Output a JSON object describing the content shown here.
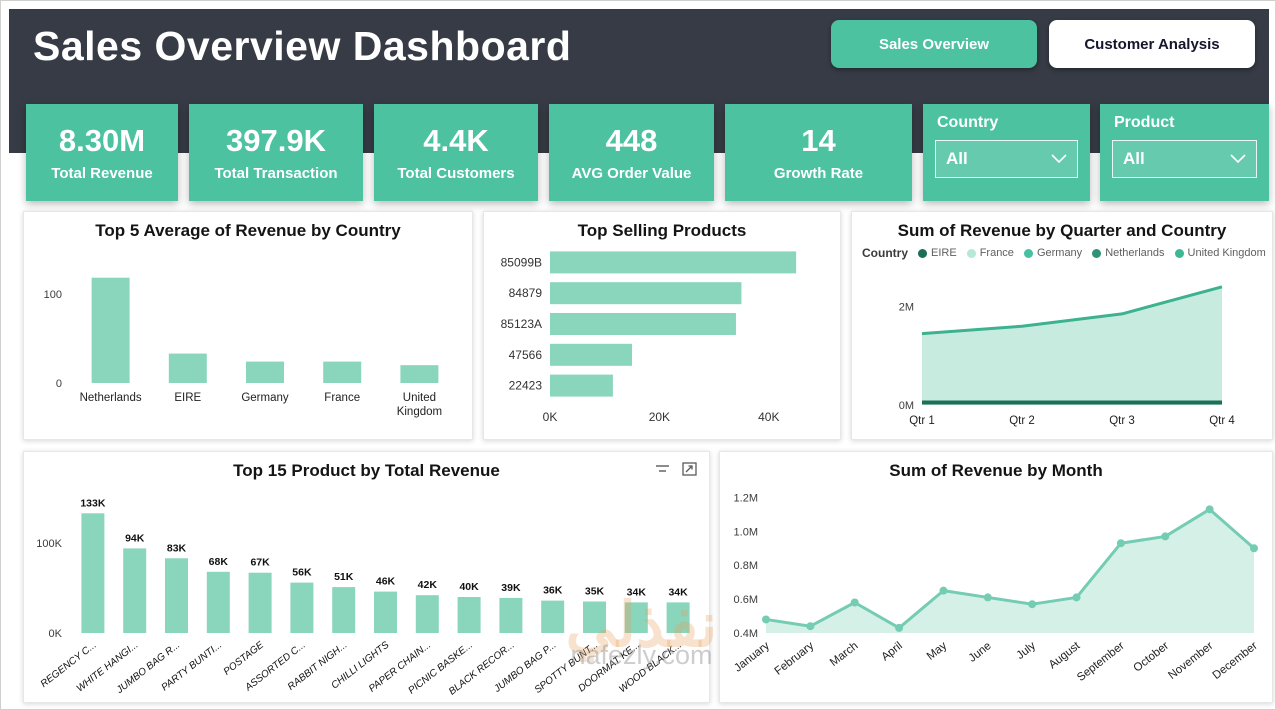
{
  "header": {
    "title": "Sales Overview Dashboard",
    "tabs": [
      {
        "label": "Sales Overview",
        "active": true
      },
      {
        "label": "Customer Analysis",
        "active": false
      }
    ]
  },
  "kpis": [
    {
      "value": "8.30M",
      "label": "Total Revenue"
    },
    {
      "value": "397.9K",
      "label": "Total Transaction"
    },
    {
      "value": "4.4K",
      "label": "Total Customers"
    },
    {
      "value": "448",
      "label": "AVG Order Value"
    },
    {
      "value": "14",
      "label": "Growth Rate"
    }
  ],
  "slicers": [
    {
      "label": "Country",
      "value": "All"
    },
    {
      "label": "Product",
      "value": "All"
    }
  ],
  "colors": {
    "accent": "#4cc2a0",
    "header_bg": "#363b45",
    "bar": "#8ad6bd",
    "area_stroke": "#3db28f",
    "area_fill": "#c8ebdf",
    "dark_series": "#1c6f58",
    "month_stroke": "#74ccb3",
    "month_fill": "#d5f0e7"
  },
  "watermark": {
    "arabic": "نفذلي",
    "domain": "nafezly.com"
  },
  "chart_data": [
    {
      "type": "bar",
      "title": "Top 5 Average of Revenue by Country",
      "categories": [
        "Netherlands",
        "EIRE",
        "Germany",
        "France",
        "United Kingdom"
      ],
      "values": [
        118,
        33,
        24,
        24,
        20
      ],
      "ylim": [
        0,
        130
      ],
      "yticks": [
        {
          "v": 100,
          "label": "100"
        },
        {
          "v": 0,
          "label": "0"
        }
      ],
      "color": "#8ad6bd",
      "grid": false,
      "xlabel": "",
      "ylabel": ""
    },
    {
      "type": "bar",
      "orientation": "horizontal",
      "title": "Top Selling Products",
      "categories": [
        "85099B",
        "84879",
        "85123A",
        "47566",
        "22423"
      ],
      "values": [
        45,
        35,
        34,
        15,
        11.5
      ],
      "unit": "K",
      "xlim": [
        0,
        49
      ],
      "xticks": [
        {
          "v": 0,
          "label": "0K"
        },
        {
          "v": 20,
          "label": "20K"
        },
        {
          "v": 40,
          "label": "40K"
        }
      ],
      "color": "#8ad6bd",
      "grid": false
    },
    {
      "type": "area",
      "title": "Sum of Revenue by Quarter and Country",
      "legend_title": "Country",
      "legend_position": "top",
      "legend": [
        {
          "label": "EIRE",
          "color": "#1b6e55"
        },
        {
          "label": "France",
          "color": "#b7e7d5"
        },
        {
          "label": "Germany",
          "color": "#46c1a1"
        },
        {
          "label": "Netherlands",
          "color": "#2f9377"
        },
        {
          "label": "United Kingdom",
          "color": "#3eb892"
        }
      ],
      "categories": [
        "Qtr 1",
        "Qtr 2",
        "Qtr 3",
        "Qtr 4"
      ],
      "series": [
        {
          "name": "United Kingdom",
          "values": [
            1.45,
            1.6,
            1.85,
            2.4
          ],
          "stroke": "#3db28f",
          "fill": "#c8ebdf",
          "width": 3
        },
        {
          "name": "EIRE",
          "values": [
            0.05,
            0.05,
            0.05,
            0.05
          ],
          "stroke": "#1c6f58",
          "width": 4
        }
      ],
      "ylim": [
        0,
        2.6
      ],
      "yticks": [
        {
          "v": 2,
          "label": "2M"
        },
        {
          "v": 0,
          "label": "0M"
        }
      ],
      "grid": false
    },
    {
      "type": "bar",
      "title": "Top 15 Product by Total Revenue",
      "categories": [
        "REGENCY C...",
        "WHITE HANGI...",
        "JUMBO BAG R...",
        "PARTY BUNTI...",
        "POSTAGE",
        "ASSORTED C...",
        "RABBIT NIGH...",
        "CHILLI LIGHTS",
        "PAPER CHAIN...",
        "PICNIC BASKE...",
        "BLACK RECOR...",
        "JUMBO BAG P...",
        "SPOTTY BUNT...",
        "DOORMAT KE...",
        "WOOD BLACK..."
      ],
      "values": [
        133,
        94,
        83,
        68,
        67,
        56,
        51,
        46,
        42,
        40,
        39,
        36,
        35,
        34,
        34
      ],
      "value_labels": [
        "133K",
        "94K",
        "83K",
        "68K",
        "67K",
        "56K",
        "51K",
        "46K",
        "42K",
        "40K",
        "39K",
        "36K",
        "35K",
        "34K",
        "34K"
      ],
      "ylim": [
        0,
        140
      ],
      "yticks": [
        {
          "v": 100,
          "label": "100K"
        },
        {
          "v": 0,
          "label": "0K"
        }
      ],
      "color": "#8ad6bd",
      "grid": false,
      "header_icons": [
        "filter-icon",
        "focus-mode-icon"
      ]
    },
    {
      "type": "area",
      "title": "Sum of Revenue by Month",
      "categories": [
        "January",
        "February",
        "March",
        "April",
        "May",
        "June",
        "July",
        "August",
        "September",
        "October",
        "November",
        "December"
      ],
      "series": [
        {
          "name": "Sum of Revenue",
          "values": [
            0.48,
            0.44,
            0.58,
            0.43,
            0.65,
            0.61,
            0.57,
            0.61,
            0.93,
            0.97,
            1.13,
            0.9
          ],
          "stroke": "#74ccb3",
          "fill": "#d5f0e7",
          "width": 3,
          "markers": true
        }
      ],
      "ylim": [
        0.4,
        1.25
      ],
      "yticks": [
        {
          "v": 1.2,
          "label": "1.2M"
        },
        {
          "v": 1.0,
          "label": "1.0M"
        },
        {
          "v": 0.8,
          "label": "0.8M"
        },
        {
          "v": 0.6,
          "label": "0.6M"
        },
        {
          "v": 0.4,
          "label": "0.4M"
        }
      ],
      "rotate_xlabels": true,
      "grid": false
    }
  ]
}
